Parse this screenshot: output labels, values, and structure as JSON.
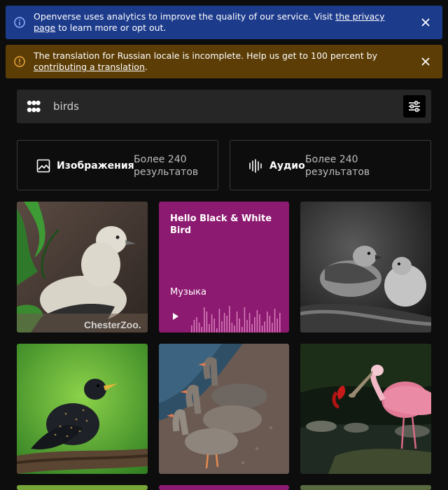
{
  "banners": {
    "analytics": {
      "text_before": "Openverse uses analytics to improve the quality of our service. Visit ",
      "link": "the privacy page",
      "text_after": " to learn more or opt out."
    },
    "translation": {
      "text_before": "The translation for Russian locale is incomplete. Help us get to 100 percent by ",
      "link": "contributing a translation",
      "text_after": "."
    }
  },
  "search": {
    "query": "birds"
  },
  "content_types": {
    "images": {
      "label": "Изображения",
      "count": "Более 240 результатов"
    },
    "audio": {
      "label": "Аудио",
      "count": "Более 240 результатов"
    }
  },
  "results": {
    "image1_watermark": "ChesterZoo.",
    "audio": {
      "title": "Hello Black & White Bird",
      "genre": "Музыка"
    }
  },
  "colors": {
    "info_banner": "#1d3b8b",
    "warning_banner": "#5c3d06",
    "audio_tile": "#8c1a70"
  }
}
